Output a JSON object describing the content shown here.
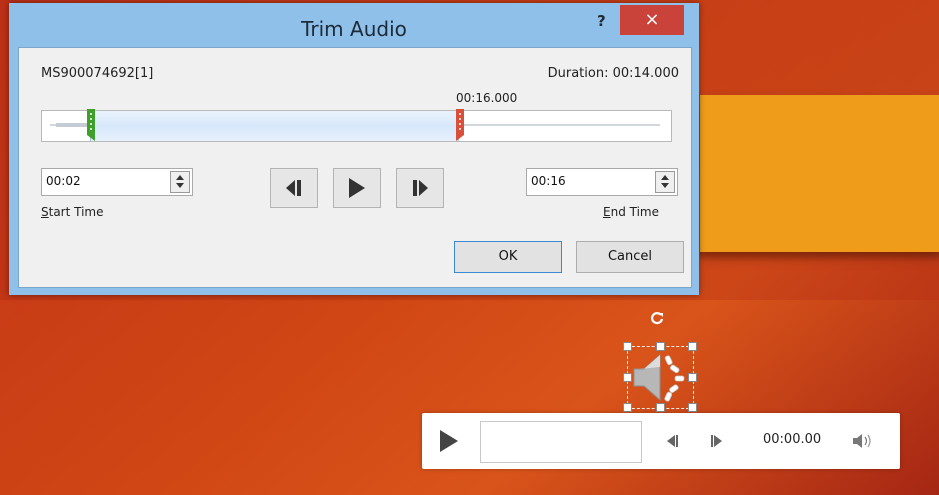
{
  "dialog": {
    "title": "Trim Audio",
    "help_label": "?",
    "close_label": "×",
    "filename": "MS900074692[1]",
    "duration": "Duration: 00:14.000",
    "end_marker_time": "00:16.000",
    "start_time": {
      "value": "00:02",
      "label_underlined": "S",
      "label_rest": "tart Time"
    },
    "end_time": {
      "value": "00:16",
      "label_underlined": "E",
      "label_rest": "nd Time"
    },
    "ok_label": "OK",
    "cancel_label": "Cancel",
    "transport": [
      {
        "name": "previous-frame-icon"
      },
      {
        "name": "play-icon"
      },
      {
        "name": "next-frame-icon"
      }
    ],
    "colors": {
      "title_bar": "#8fc0ea",
      "close": "#c9433a",
      "start_marker": "#3ea02a",
      "end_marker": "#d9503a",
      "selection": "#d7e8fb"
    }
  },
  "slide": {
    "colors": {
      "background": "#cf4514",
      "band": "#f09c1b"
    }
  },
  "audio_controls": {
    "time": "00:00.00",
    "icons": [
      "play-icon",
      "back-icon",
      "forward-icon",
      "volume-icon"
    ]
  }
}
